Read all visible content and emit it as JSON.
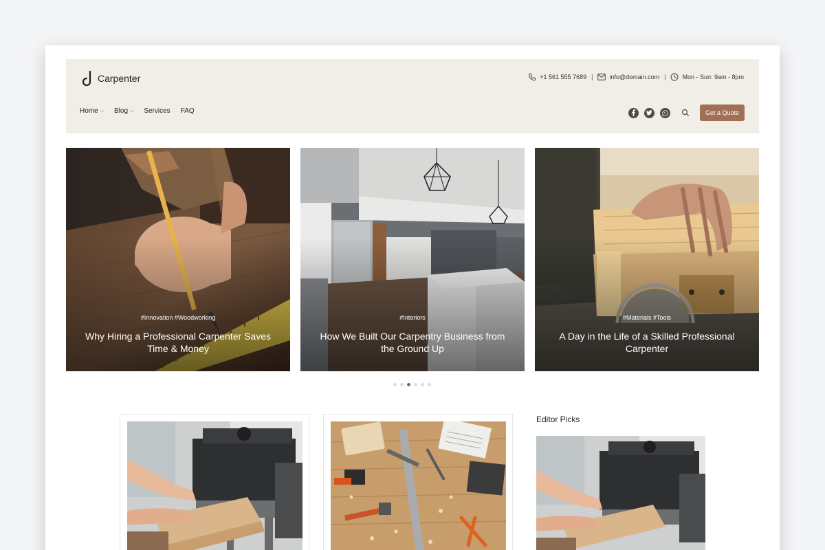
{
  "header": {
    "logo_text": "Carpenter",
    "phone": "+1 561 555 7689",
    "email": "info@domain.com",
    "hours": "Mon - Sun: 9am - 8pm",
    "separator": "|",
    "nav": [
      {
        "label": "Home",
        "has_dropdown": true
      },
      {
        "label": "Blog",
        "has_dropdown": true
      },
      {
        "label": "Services",
        "has_dropdown": false
      },
      {
        "label": "FAQ",
        "has_dropdown": false
      }
    ],
    "social_icons": [
      "facebook-icon",
      "twitter-icon",
      "whatsapp-icon"
    ],
    "quote_button": "Get a Quote"
  },
  "slides": [
    {
      "tags": "#Innovation #Woodworking",
      "title": "Why Hiring a Professional Carpenter Saves Time & Money"
    },
    {
      "tags": "#Interiors",
      "title": "How We Built Our Carpentry Business from the Ground Up"
    },
    {
      "tags": "#Materials #Tools",
      "title": "A Day in the Life of a Skilled Professional Carpenter"
    }
  ],
  "carousel": {
    "dot_count": 6,
    "active_dot": 3
  },
  "editor_picks": {
    "title": "Editor Picks"
  },
  "colors": {
    "accent": "#a16f55",
    "header_bg": "#f1eee8",
    "active_dot": "#8a6a55"
  }
}
